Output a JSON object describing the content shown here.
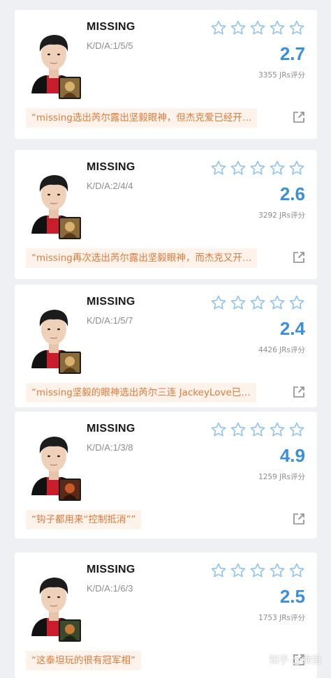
{
  "cards": [
    {
      "name": "MISSING",
      "kda": "K/D/A:1/5/5",
      "score": "2.7",
      "votes": "3355 JRs评分",
      "quote": "“missing选出芮尔露出坚毅眼神，但杰克爱已经开…",
      "champion_icon": "champion-portrait-icon",
      "stars_filled": 0
    },
    {
      "name": "MISSING",
      "kda": "K/D/A:2/4/4",
      "score": "2.6",
      "votes": "3292 JRs评分",
      "quote": "“missing再次选出芮尔露出坚毅眼神，而杰克又开…",
      "champion_icon": "champion-portrait-icon",
      "stars_filled": 0
    },
    {
      "name": "MISSING",
      "kda": "K/D/A:1/5/7",
      "score": "2.4",
      "votes": "4426 JRs评分",
      "quote": "“missing坚毅的眼神选出芮尔三连 JackeyLove已…",
      "champion_icon": "champion-portrait-icon",
      "stars_filled": 0
    },
    {
      "name": "MISSING",
      "kda": "K/D/A:1/3/8",
      "score": "4.9",
      "votes": "1259 JRs评分",
      "quote": "“钩子都用来“控制抵消””",
      "champion_icon": "champion-portrait-icon",
      "stars_filled": 0
    },
    {
      "name": "MISSING",
      "kda": "K/D/A:1/6/3",
      "score": "2.5",
      "votes": "1753 JRs评分",
      "quote": "“这泰坦玩的很有冠军相”",
      "champion_icon": "champion-portrait-icon",
      "stars_filled": 0
    }
  ],
  "watermark": "知乎 @乘悟",
  "colors": {
    "score": "#3a8fd9",
    "star_outline": "#8ec3ee",
    "quote_text": "#e07a3c",
    "quote_bg": "#fdf3ea",
    "page_bg": "#eef0f3"
  },
  "icons": {
    "star": "star-outline-icon",
    "share": "external-link-icon",
    "avatar": "player-avatar"
  }
}
